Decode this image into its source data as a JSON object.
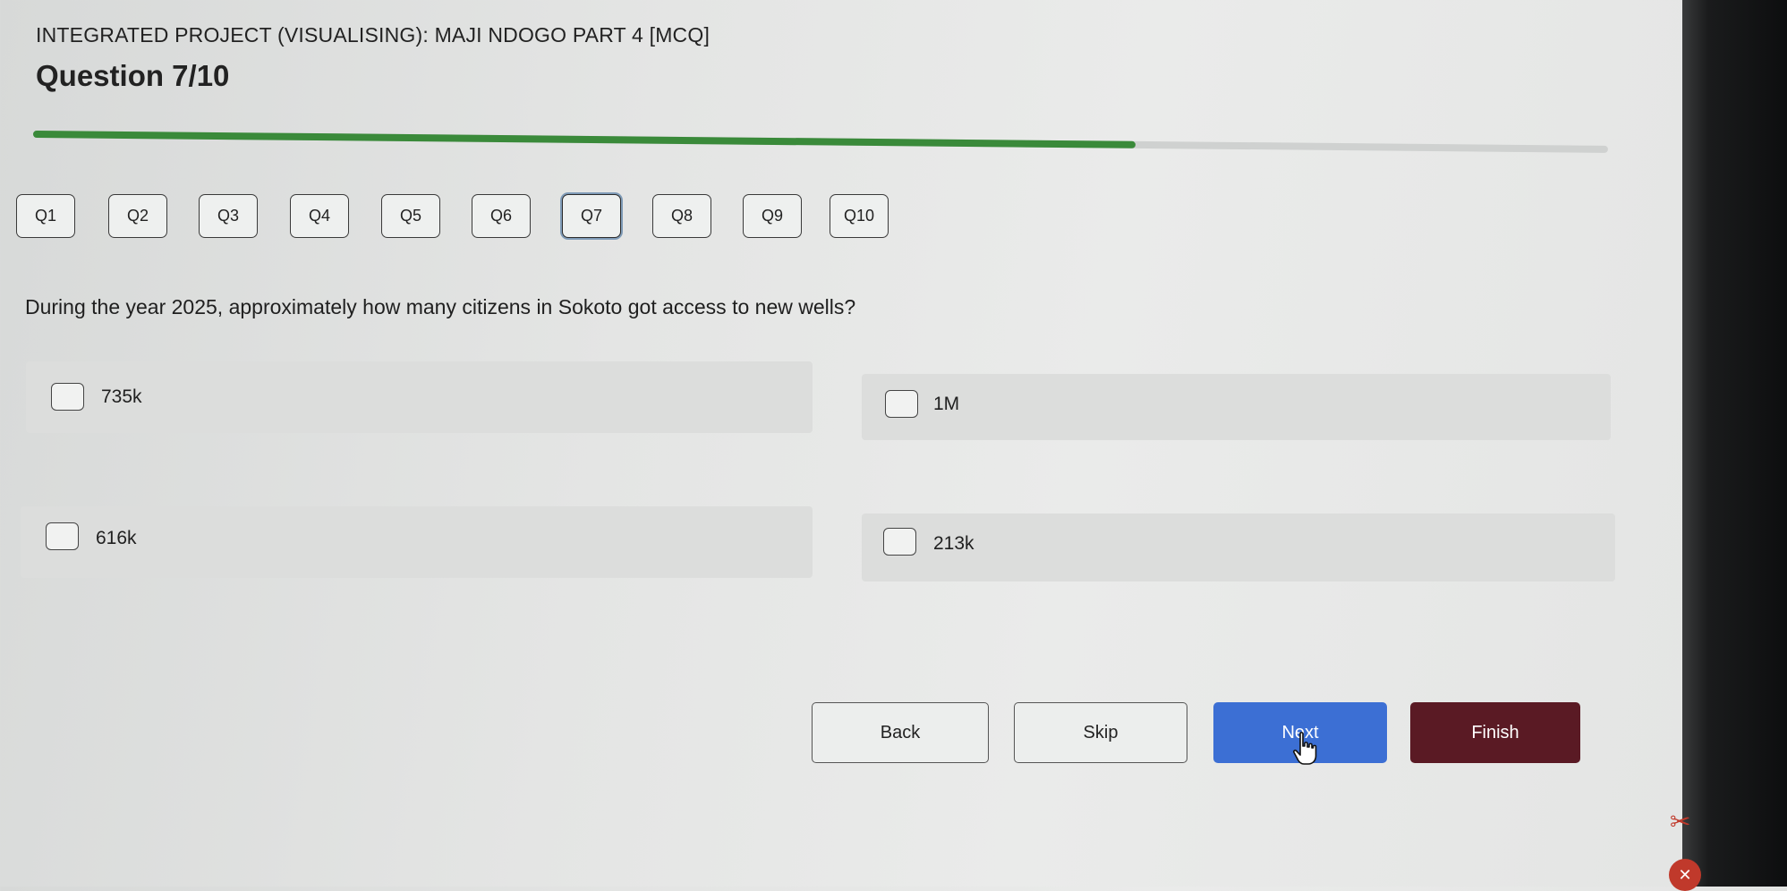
{
  "header": {
    "title": "INTEGRATED PROJECT (VISUALISING): MAJI NDOGO PART 4 [MCQ]",
    "question_heading": "Question 7/10",
    "progress": 0.7
  },
  "question_nav": [
    {
      "label": "Q1",
      "current": false
    },
    {
      "label": "Q2",
      "current": false
    },
    {
      "label": "Q3",
      "current": false
    },
    {
      "label": "Q4",
      "current": false
    },
    {
      "label": "Q5",
      "current": false
    },
    {
      "label": "Q6",
      "current": false
    },
    {
      "label": "Q7",
      "current": true
    },
    {
      "label": "Q8",
      "current": false
    },
    {
      "label": "Q9",
      "current": false
    },
    {
      "label": "Q10",
      "current": false
    }
  ],
  "question": {
    "text": "During the year 2025, approximately how many citizens in Sokoto got access to new wells?",
    "options": [
      {
        "label": "735k",
        "checked": false
      },
      {
        "label": "1M",
        "checked": false
      },
      {
        "label": "616k",
        "checked": false
      },
      {
        "label": "213k",
        "checked": false
      }
    ]
  },
  "buttons": {
    "back": "Back",
    "skip": "Skip",
    "next": "Next",
    "finish": "Finish"
  },
  "colors": {
    "progress": "#3a8a3a",
    "next": "#3c6fd4",
    "finish": "#5a1a24"
  },
  "icons": {
    "cursor": "hand-pointer-icon",
    "tray_1": "scissors-icon",
    "tray_2": "badge-icon"
  }
}
